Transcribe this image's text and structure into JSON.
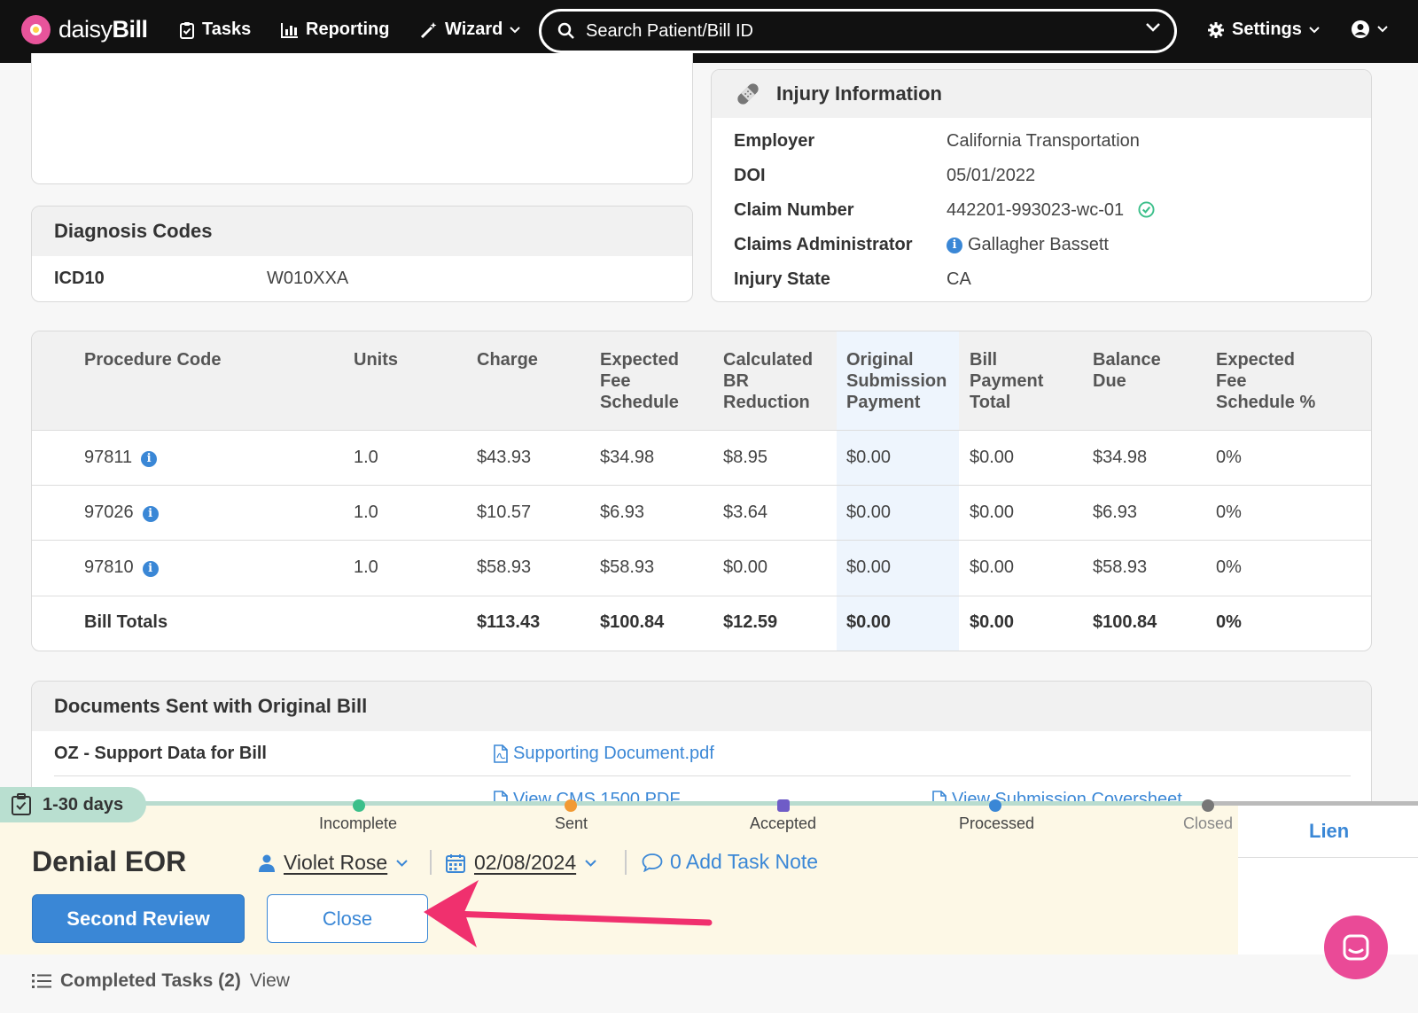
{
  "app": {
    "logo_light": "daisy",
    "logo_bold": "Bill",
    "nav": {
      "tasks": "Tasks",
      "reporting": "Reporting",
      "wizard": "Wizard",
      "settings": "Settings"
    },
    "search_placeholder": "Search Patient/Bill ID"
  },
  "injury": {
    "title": "Injury Information",
    "rows": [
      {
        "label": "Employer",
        "value": "California Transportation"
      },
      {
        "label": "DOI",
        "value": "05/01/2022"
      },
      {
        "label": "Claim Number",
        "value": "442201-993023-wc-01"
      },
      {
        "label": "Claims Administrator",
        "value": "Gallagher Bassett"
      },
      {
        "label": "Injury State",
        "value": "CA"
      }
    ]
  },
  "diagnosis": {
    "title": "Diagnosis Codes",
    "code_type": "ICD10",
    "code": "W010XXA"
  },
  "procedures": {
    "headers": [
      "Procedure Code",
      "Units",
      "Charge",
      "Expected Fee Schedule",
      "Calculated BR Reduction",
      "Original Submission Payment",
      "Bill Payment Total",
      "Balance Due",
      "Expected Fee Schedule %"
    ],
    "header_lines": [
      [
        "Procedure Code"
      ],
      [
        "Units"
      ],
      [
        "Charge"
      ],
      [
        "Expected",
        "Fee",
        "Schedule"
      ],
      [
        "Calculated",
        "BR",
        "Reduction"
      ],
      [
        "Original",
        "Submission",
        "Payment"
      ],
      [
        "Bill",
        "Payment",
        "Total"
      ],
      [
        "Balance",
        "Due"
      ],
      [
        "Expected",
        "Fee",
        "Schedule %"
      ]
    ],
    "rows": [
      [
        "97811",
        "1.0",
        "$43.93",
        "$34.98",
        "$8.95",
        "$0.00",
        "$0.00",
        "$34.98",
        "0%"
      ],
      [
        "97026",
        "1.0",
        "$10.57",
        "$6.93",
        "$3.64",
        "$0.00",
        "$0.00",
        "$6.93",
        "0%"
      ],
      [
        "97810",
        "1.0",
        "$58.93",
        "$58.93",
        "$0.00",
        "$0.00",
        "$0.00",
        "$58.93",
        "0%"
      ]
    ],
    "totals": [
      "Bill Totals",
      "",
      "$113.43",
      "$100.84",
      "$12.59",
      "$0.00",
      "$0.00",
      "$100.84",
      "0%"
    ]
  },
  "documents": {
    "title": "Documents Sent with Original Bill",
    "items": [
      {
        "label": "OZ - Support Data for Bill",
        "file": "Supporting Document.pdf"
      }
    ],
    "links": [
      "View CMS 1500 PDF",
      "View Submission Coversheet"
    ]
  },
  "task": {
    "age_badge": "1-30 days",
    "steps": [
      "Incomplete",
      "Sent",
      "Accepted",
      "Processed",
      "Closed"
    ],
    "side_tab": "Lien",
    "title": "Denial EOR",
    "assignee": "Violet Rose",
    "date": "02/08/2024",
    "note": "0 Add Task Note",
    "primary_button": "Second Review",
    "secondary_button": "Close",
    "completed_label": "Completed Tasks (2)",
    "completed_link": "View"
  },
  "colors": {
    "accent": "#3a87d6",
    "brand_pink": "#e8549b",
    "arrow": "#f0306e",
    "panel": "#fdf8e6"
  }
}
